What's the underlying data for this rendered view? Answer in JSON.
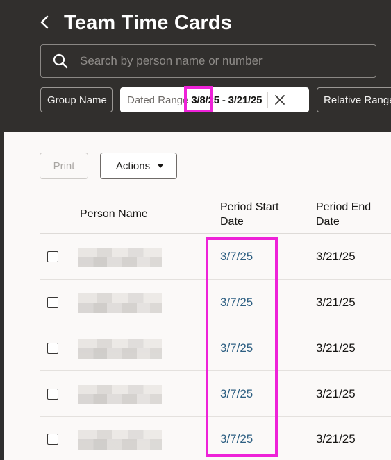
{
  "header": {
    "title": "Team Time Cards",
    "back_icon": "chevron-left-icon"
  },
  "search": {
    "placeholder": "Search by person name or number",
    "value": ""
  },
  "filters": {
    "group_name": "Group Name",
    "dated_range_label": "Dated Range",
    "dated_range_value": "3/8/25 - 3/21/25",
    "relative_range": "Relative Range"
  },
  "toolbar": {
    "print_label": "Print",
    "actions_label": "Actions"
  },
  "table": {
    "columns": {
      "person_name": "Person Name",
      "period_start_line1": "Period Start",
      "period_start_line2": "Date",
      "period_end_line1": "Period End",
      "period_end_line2": "Date"
    },
    "rows": [
      {
        "period_start": "3/7/25",
        "period_end": "3/21/25"
      },
      {
        "period_start": "3/7/25",
        "period_end": "3/21/25"
      },
      {
        "period_start": "3/7/25",
        "period_end": "3/21/25"
      },
      {
        "period_start": "3/7/25",
        "period_end": "3/21/25"
      },
      {
        "period_start": "3/7/25",
        "period_end": "3/21/25"
      }
    ]
  },
  "colors": {
    "header_bg": "#312f2d",
    "link": "#2d5f82",
    "highlight": "#ee22d8"
  }
}
